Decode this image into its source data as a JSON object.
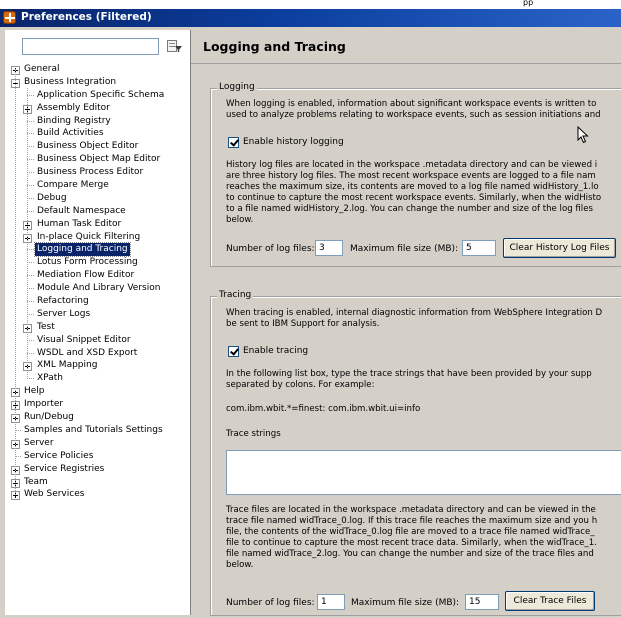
{
  "window": {
    "topstrip_text": "pp",
    "title": "Preferences (Filtered)"
  },
  "filter": {
    "value": "",
    "placeholder": ""
  },
  "tree": [
    {
      "label": "General",
      "level": 0,
      "expander": "plus"
    },
    {
      "label": "Business Integration",
      "level": 0,
      "expander": "minus"
    },
    {
      "label": "Application Specific Schema",
      "level": 1,
      "expander": "none"
    },
    {
      "label": "Assembly Editor",
      "level": 1,
      "expander": "plus"
    },
    {
      "label": "Binding Registry",
      "level": 1,
      "expander": "none"
    },
    {
      "label": "Build Activities",
      "level": 1,
      "expander": "none"
    },
    {
      "label": "Business Object Editor",
      "level": 1,
      "expander": "none"
    },
    {
      "label": "Business Object Map Editor",
      "level": 1,
      "expander": "none"
    },
    {
      "label": "Business Process Editor",
      "level": 1,
      "expander": "none"
    },
    {
      "label": "Compare Merge",
      "level": 1,
      "expander": "none"
    },
    {
      "label": "Debug",
      "level": 1,
      "expander": "none"
    },
    {
      "label": "Default Namespace",
      "level": 1,
      "expander": "none"
    },
    {
      "label": "Human Task Editor",
      "level": 1,
      "expander": "plus"
    },
    {
      "label": "In-place Quick Filtering",
      "level": 1,
      "expander": "plus"
    },
    {
      "label": "Logging and Tracing",
      "level": 1,
      "expander": "none",
      "selected": true
    },
    {
      "label": "Lotus Form Processing",
      "level": 1,
      "expander": "none"
    },
    {
      "label": "Mediation Flow Editor",
      "level": 1,
      "expander": "none"
    },
    {
      "label": "Module And Library Version",
      "level": 1,
      "expander": "none"
    },
    {
      "label": "Refactoring",
      "level": 1,
      "expander": "none"
    },
    {
      "label": "Server Logs",
      "level": 1,
      "expander": "none"
    },
    {
      "label": "Test",
      "level": 1,
      "expander": "plus"
    },
    {
      "label": "Visual Snippet Editor",
      "level": 1,
      "expander": "none"
    },
    {
      "label": "WSDL and XSD Export",
      "level": 1,
      "expander": "none"
    },
    {
      "label": "XML Mapping",
      "level": 1,
      "expander": "plus"
    },
    {
      "label": "XPath",
      "level": 1,
      "expander": "none"
    },
    {
      "label": "Help",
      "level": 0,
      "expander": "plus"
    },
    {
      "label": "Importer",
      "level": 0,
      "expander": "plus"
    },
    {
      "label": "Run/Debug",
      "level": 0,
      "expander": "plus"
    },
    {
      "label": "Samples and Tutorials Settings",
      "level": 0,
      "expander": "none"
    },
    {
      "label": "Server",
      "level": 0,
      "expander": "plus"
    },
    {
      "label": "Service Policies",
      "level": 0,
      "expander": "none"
    },
    {
      "label": "Service Registries",
      "level": 0,
      "expander": "plus"
    },
    {
      "label": "Team",
      "level": 0,
      "expander": "plus"
    },
    {
      "label": "Web Services",
      "level": 0,
      "expander": "plus"
    }
  ],
  "page": {
    "title": "Logging and Tracing",
    "logging": {
      "legend": "Logging",
      "intro": [
        "When logging is enabled, information about significant workspace events is written to",
        "used to analyze problems relating to workspace events, such as session initiations and"
      ],
      "enable_label": "Enable history logging",
      "enable_checked": true,
      "details": [
        "History log files are located in the workspace .metadata directory and can be viewed i",
        "are three history log files. The most recent workspace events are logged to a file nam",
        "reaches the maximum size, its contents are moved to a log file named widHistory_1.lo",
        "to continue to capture the most recent workspace events. Similarly, when the widHisto",
        "to a file named widHistory_2.log. You can change the number and size of the log files",
        "below."
      ],
      "num_files_label": "Number of log files:",
      "num_files_value": "3",
      "max_size_label": "Maximum file size (MB):",
      "max_size_value": "5",
      "clear_button": "Clear History Log Files"
    },
    "tracing": {
      "legend": "Tracing",
      "intro": [
        "When tracing is enabled, internal diagnostic information from WebSphere Integration D",
        "be sent to IBM Support for analysis."
      ],
      "enable_label": "Enable tracing",
      "enable_checked": true,
      "list_intro": [
        "In the following list box, type the trace strings that have been provided by your supp",
        "separated by colons. For example:"
      ],
      "example": "com.ibm.wbit.*=finest: com.ibm.wbit.ui=info",
      "strings_label": "Trace strings",
      "strings_value": "",
      "details": [
        "Trace files are located in the workspace .metadata directory and can be viewed in the",
        "trace file named widTrace_0.log. If this trace file reaches the maximum size and you h",
        "file, the contents of the widTrace_0.log file are moved to a trace file named widTrace_",
        "file to continue to capture the most recent trace data. Similarly, when the widTrace_1.",
        "file named widTrace_2.log. You can change the number and size of the trace files and",
        "below."
      ],
      "num_files_label": "Number of log files:",
      "num_files_value": "1",
      "max_size_label": "Maximum file size (MB):",
      "max_size_value": "15",
      "clear_button": "Clear Trace Files"
    }
  }
}
